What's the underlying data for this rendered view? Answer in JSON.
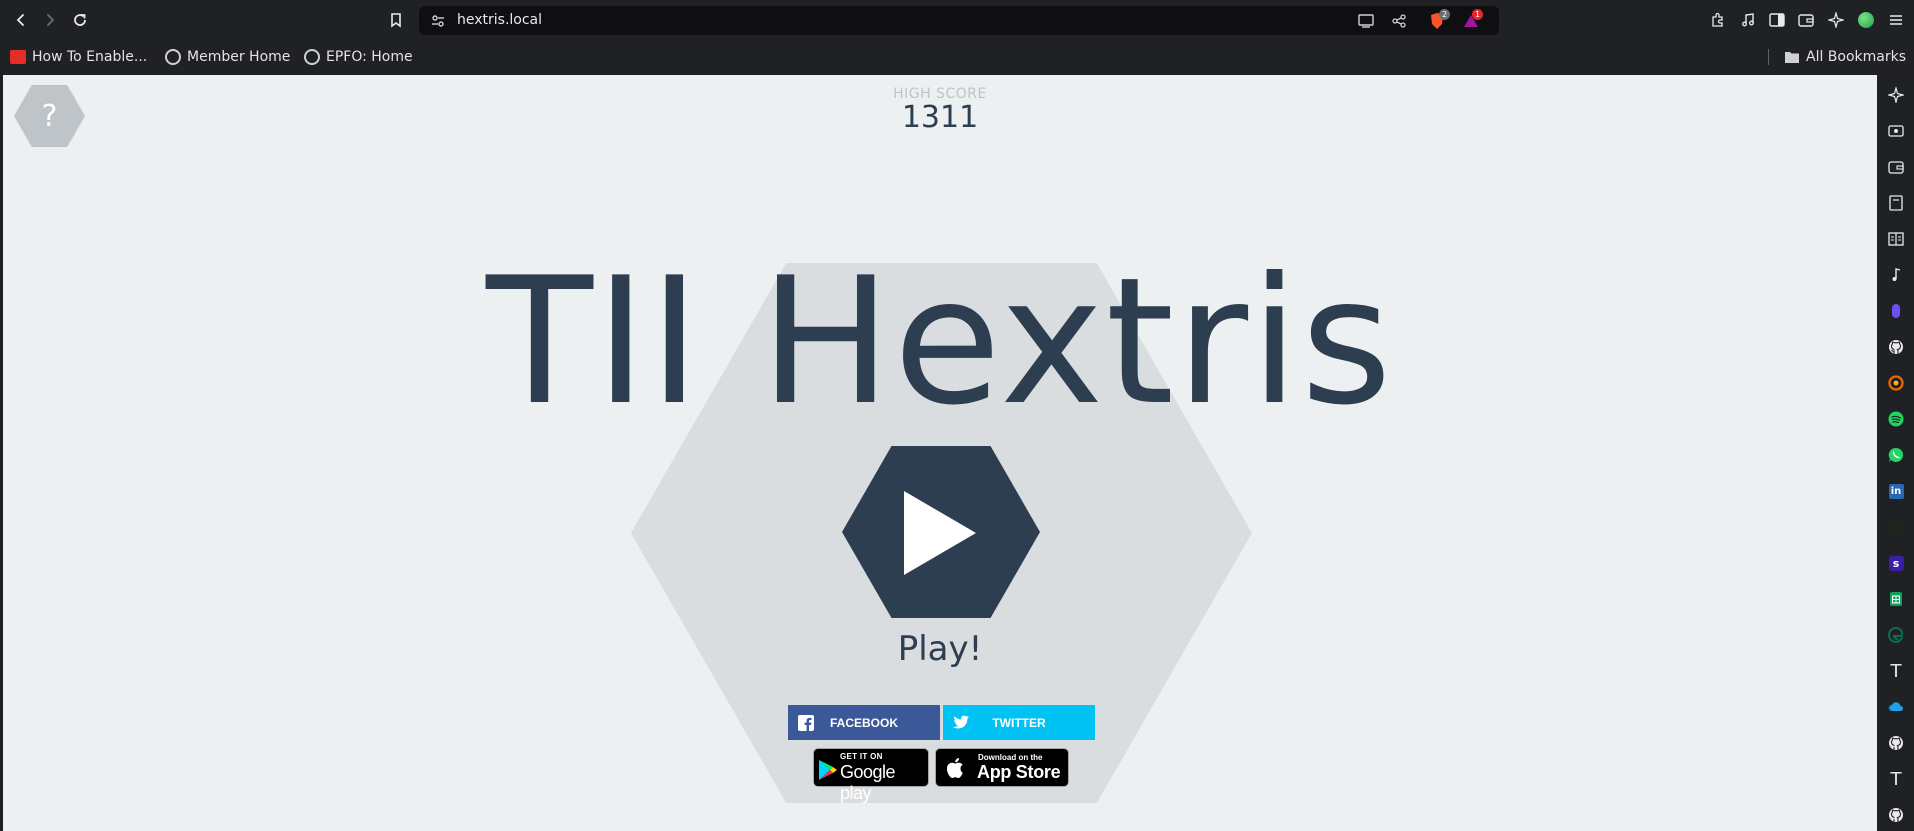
{
  "browser": {
    "url": "hextris.local",
    "brave_shield_badge": "2",
    "rewards_badge": "1"
  },
  "bookmarks": {
    "items": [
      {
        "label": "How To Enable..."
      },
      {
        "label": "Member Home"
      },
      {
        "label": "EPFO: Home"
      }
    ],
    "all_label": "All Bookmarks"
  },
  "game": {
    "help_label": "?",
    "high_score_label": "HIGH SCORE",
    "high_score_value": "1311",
    "title": "TII Hextris",
    "play_label": "Play!",
    "facebook_label": "FACEBOOK",
    "twitter_label": "TWITTER",
    "google_small": "GET IT ON",
    "google_big": "Google play",
    "apple_small": "Download on the",
    "apple_big": "App Store"
  },
  "sidebar": {
    "icons": [
      "leo-ai-icon",
      "video-icon",
      "wallet-icon",
      "reading-list-icon",
      "reader-mode-icon",
      "music-icon",
      "app-icon",
      "github-icon",
      "grafana-icon",
      "spotify-icon",
      "whatsapp-icon",
      "linkedin-icon",
      "openai-icon",
      "slack-icon",
      "sheets-icon",
      "edge-icon",
      "text-icon",
      "cloud-icon",
      "github-icon",
      "text-icon",
      "github-icon"
    ]
  },
  "colors": {
    "game_bg": "#ecf0f1",
    "hex_bg": "#dadde0",
    "primary": "#2c3e50",
    "facebook": "#3b5998",
    "twitter": "#00c3f3"
  }
}
